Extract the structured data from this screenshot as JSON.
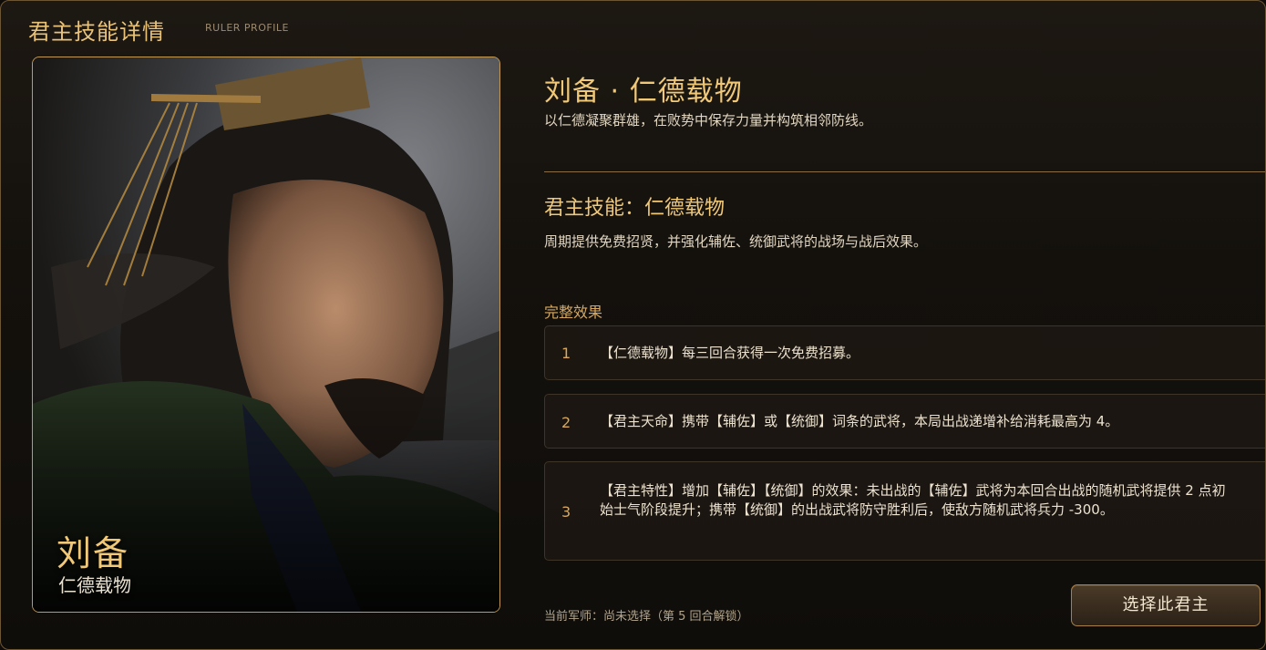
{
  "header": {
    "title": "君主技能详情",
    "subtitle": "RULER PROFILE"
  },
  "portrait": {
    "name": "刘备",
    "title": "仁德载物"
  },
  "skill": {
    "title": "刘备 · 仁德载物",
    "description": "以仁德凝聚群雄，在败势中保存力量并构筑相邻防线。"
  },
  "ruler_skill": {
    "title": "君主技能：仁德载物",
    "description": "周期提供免费招贤，并强化辅佐、统御武将的战场与战后效果。"
  },
  "effects": {
    "label": "完整效果",
    "items": [
      {
        "num": "1",
        "text": "【仁德载物】每三回合获得一次免费招募。"
      },
      {
        "num": "2",
        "text": "【君主天命】携带【辅佐】或【统御】词条的武将，本局出战递增补给消耗最高为 4。"
      },
      {
        "num": "3",
        "text": "【君主特性】增加【辅佐】【统御】的效果：未出战的【辅佐】武将为本回合出战的随机武将提供 2 点初始士气阶段提升；携带【统御】的出战武将防守胜利后，使敌方随机武将兵力 -300。"
      }
    ]
  },
  "footer": {
    "advisor_status": "当前军师：尚未选择（第 5 回合解锁）",
    "select_button": "选择此君主"
  },
  "colors": {
    "accent_gold": "#f0c877",
    "border_gold": "#c39a55",
    "background": "#14110d"
  }
}
